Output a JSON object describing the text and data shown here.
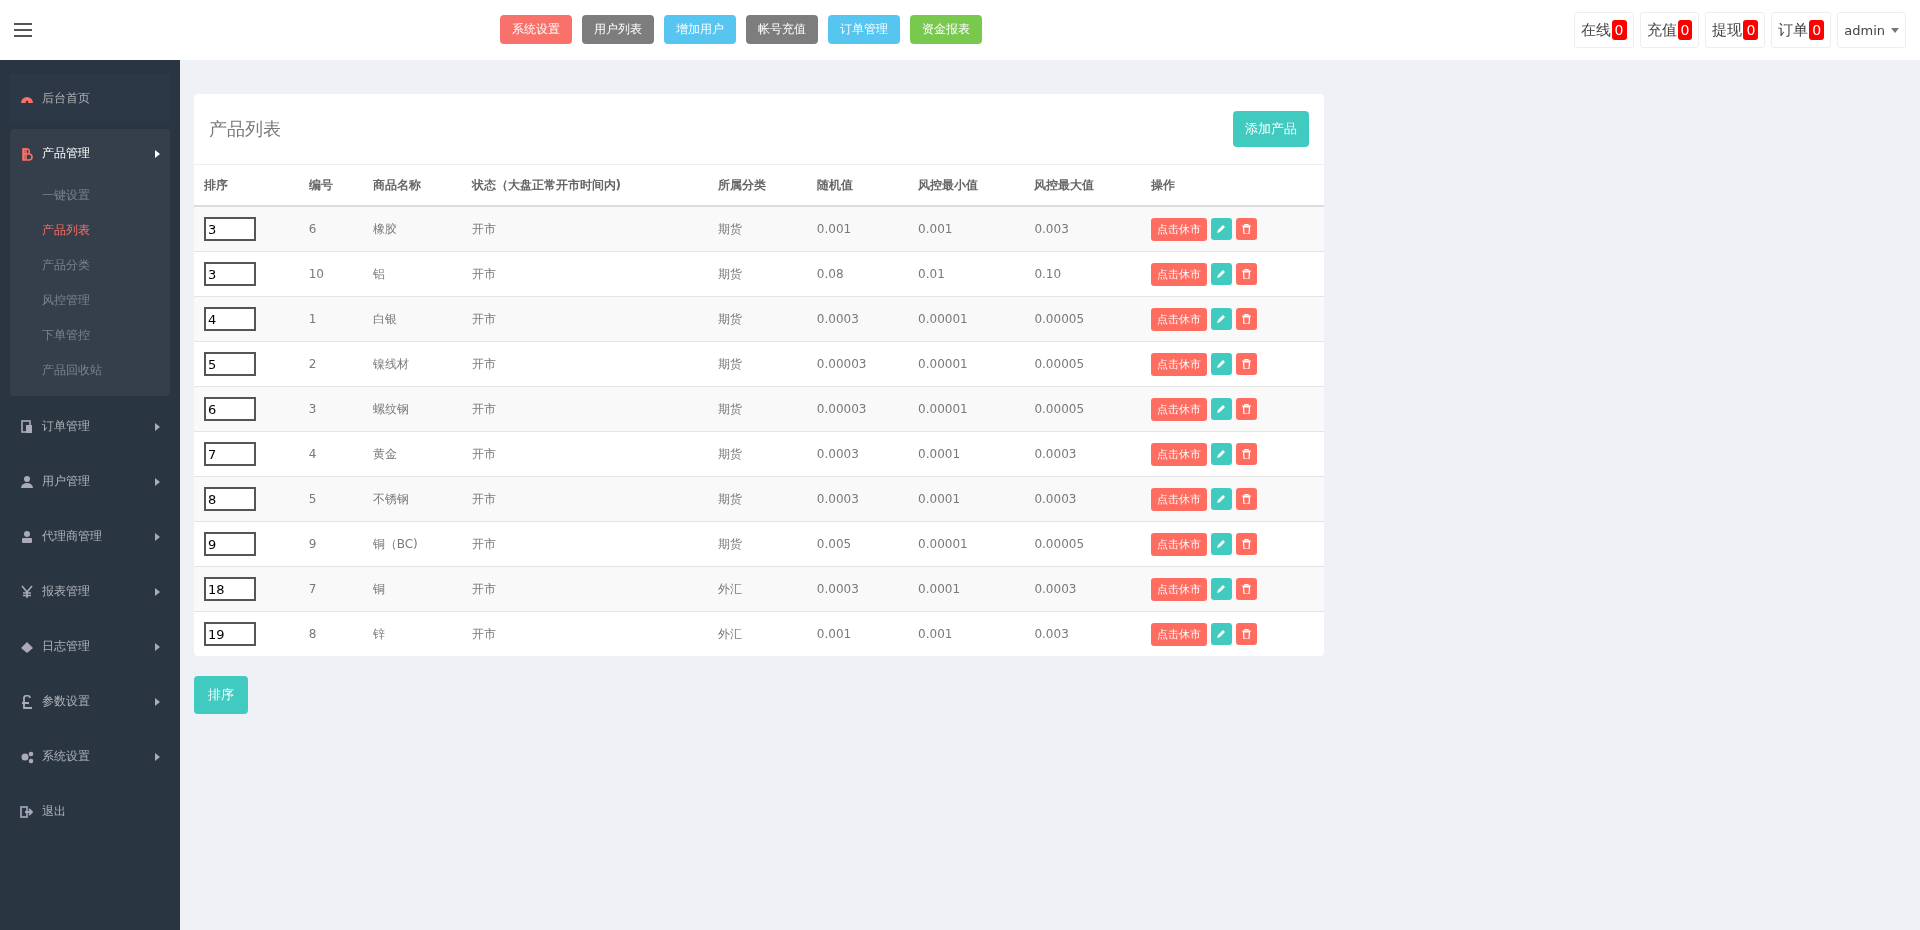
{
  "topbar": {
    "nav_buttons": [
      {
        "label": "系统设置",
        "color": "#f8716a"
      },
      {
        "label": "用户列表",
        "color": "#7d7d7d"
      },
      {
        "label": "增加用户",
        "color": "#56c5f0"
      },
      {
        "label": "帐号充值",
        "color": "#7d7d7d"
      },
      {
        "label": "订单管理",
        "color": "#56c5f0"
      },
      {
        "label": "资金报表",
        "color": "#7ac94f"
      }
    ],
    "counters": [
      {
        "label": "在线",
        "count": "0"
      },
      {
        "label": "充值",
        "count": "0"
      },
      {
        "label": "提现",
        "count": "0"
      },
      {
        "label": "订单",
        "count": "0"
      }
    ],
    "user": "admin"
  },
  "sidebar": {
    "items": [
      {
        "label": "后台首页",
        "kind": "link",
        "selected": false
      },
      {
        "label": "产品管理",
        "kind": "menu",
        "selected": true,
        "children": [
          {
            "label": "一键设置",
            "selected": false
          },
          {
            "label": "产品列表",
            "selected": true
          },
          {
            "label": "产品分类",
            "selected": false
          },
          {
            "label": "风控管理",
            "selected": false
          },
          {
            "label": "下单管控",
            "selected": false
          },
          {
            "label": "产品回收站",
            "selected": false
          }
        ]
      },
      {
        "label": "订单管理",
        "kind": "menu",
        "selected": false
      },
      {
        "label": "用户管理",
        "kind": "menu",
        "selected": false
      },
      {
        "label": "代理商管理",
        "kind": "menu",
        "selected": false
      },
      {
        "label": "报表管理",
        "kind": "menu",
        "selected": false
      },
      {
        "label": "日志管理",
        "kind": "menu",
        "selected": false
      },
      {
        "label": "参数设置",
        "kind": "menu",
        "selected": false
      },
      {
        "label": "系统设置",
        "kind": "menu",
        "selected": false
      },
      {
        "label": "退出",
        "kind": "link",
        "selected": false
      }
    ]
  },
  "panel": {
    "title": "产品列表",
    "add_button": "添加产品",
    "columns": [
      "排序",
      "编号",
      "商品名称",
      "状态（大盘正常开市时间内)",
      "所属分类",
      "随机值",
      "风控最小值",
      "风控最大值",
      "操作"
    ],
    "rows": [
      {
        "sort": "3",
        "id": "6",
        "name": "橡胶",
        "status": "开市",
        "category": "期货",
        "random": "0.001",
        "min": "0.001",
        "max": "0.003",
        "toggle": "点击休市"
      },
      {
        "sort": "3",
        "id": "10",
        "name": "铝",
        "status": "开市",
        "category": "期货",
        "random": "0.08",
        "min": "0.01",
        "max": "0.10",
        "toggle": "点击休市"
      },
      {
        "sort": "4",
        "id": "1",
        "name": "白银",
        "status": "开市",
        "category": "期货",
        "random": "0.0003",
        "min": "0.00001",
        "max": "0.00005",
        "toggle": "点击休市"
      },
      {
        "sort": "5",
        "id": "2",
        "name": "镍线材",
        "status": "开市",
        "category": "期货",
        "random": "0.00003",
        "min": "0.00001",
        "max": "0.00005",
        "toggle": "点击休市"
      },
      {
        "sort": "6",
        "id": "3",
        "name": "螺纹钢",
        "status": "开市",
        "category": "期货",
        "random": "0.00003",
        "min": "0.00001",
        "max": "0.00005",
        "toggle": "点击休市"
      },
      {
        "sort": "7",
        "id": "4",
        "name": "黄金",
        "status": "开市",
        "category": "期货",
        "random": "0.0003",
        "min": "0.0001",
        "max": "0.0003",
        "toggle": "点击休市"
      },
      {
        "sort": "8",
        "id": "5",
        "name": "不锈钢",
        "status": "开市",
        "category": "期货",
        "random": "0.0003",
        "min": "0.0001",
        "max": "0.0003",
        "toggle": "点击休市"
      },
      {
        "sort": "9",
        "id": "9",
        "name": "铜（BC)",
        "status": "开市",
        "category": "期货",
        "random": "0.005",
        "min": "0.00001",
        "max": "0.00005",
        "toggle": "点击休市"
      },
      {
        "sort": "18",
        "id": "7",
        "name": "铜",
        "status": "开市",
        "category": "外汇",
        "random": "0.0003",
        "min": "0.0001",
        "max": "0.0003",
        "toggle": "点击休市"
      },
      {
        "sort": "19",
        "id": "8",
        "name": "锌",
        "status": "开市",
        "category": "外汇",
        "random": "0.001",
        "min": "0.001",
        "max": "0.003",
        "toggle": "点击休市"
      }
    ]
  },
  "sort_button": "排序"
}
